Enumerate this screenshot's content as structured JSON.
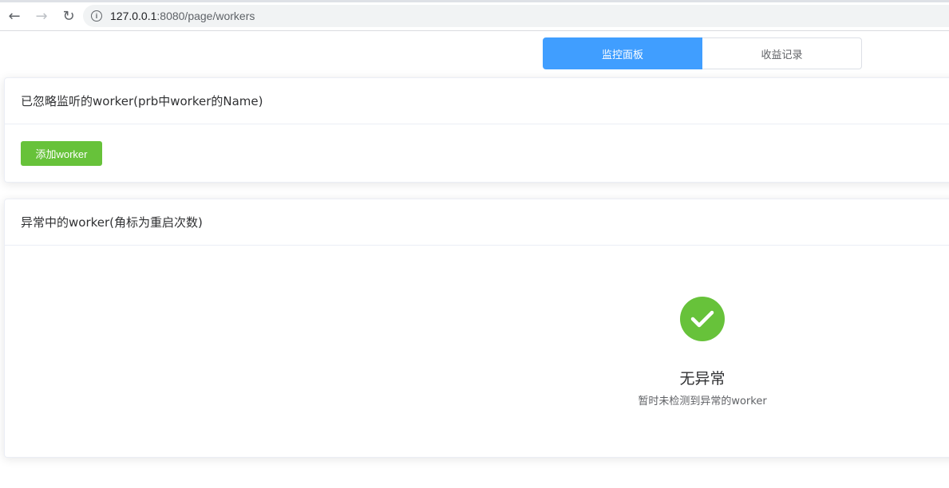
{
  "browser": {
    "url_host": "127.0.0.1",
    "url_rest": ":8080/page/workers"
  },
  "tabs": [
    {
      "label": "监控面板",
      "active": true
    },
    {
      "label": "收益记录",
      "active": false
    }
  ],
  "ignored": {
    "title": "已忽略监听的worker(prb中worker的Name)",
    "add_button": "添加worker"
  },
  "abnormal": {
    "title": "异常中的worker(角标为重启次数)",
    "empty_title": "无异常",
    "empty_sub": "暂时未检测到异常的worker"
  },
  "colors": {
    "primary": "#409eff",
    "success": "#67c23a"
  }
}
